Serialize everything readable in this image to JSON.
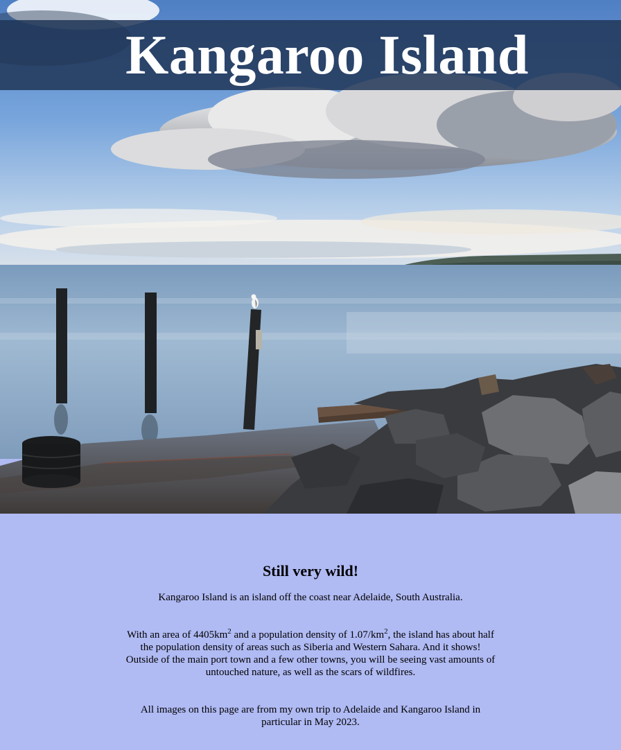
{
  "header": {
    "title": "Kangaroo Island"
  },
  "hero_image": {
    "icon": "coastal-photo",
    "description_icon": "seagull-on-pier-post"
  },
  "section": {
    "heading": "Still very wild!",
    "intro": "Kangaroo Island is an island off the coast near Adelaide, South Australia.",
    "stats_part1": "With an area of 4405km",
    "stats_sup1": "2",
    "stats_part2": " and a population density of 1.07/km",
    "stats_sup2": "2",
    "stats_part3": ", the island has about half the population density of areas such as Siberia and Western Sahara. And it shows! Outside of the main port town and a few other towns, you will be seeing vast amounts of untouched nature, as well as the scars of wildfires.",
    "note": "All images on this page are from my own trip to Adelaide and Kangaroo Island in particular in May 2023."
  },
  "colors": {
    "page_background": "#b0baf3",
    "title_bar": "#1f3456",
    "title_text": "#ffffff"
  }
}
